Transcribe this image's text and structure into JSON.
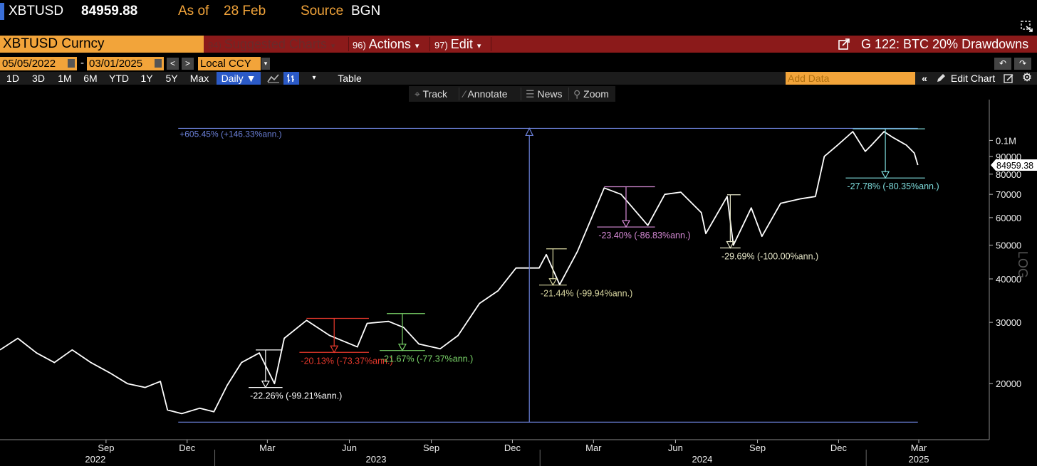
{
  "header": {
    "ticker": "XBTUSD",
    "price": "84959.88",
    "asof_label": "As of",
    "asof_date": "28 Feb",
    "source_label": "Source",
    "source_value": "BGN"
  },
  "security_bar": {
    "security": "XBTUSD Curncy",
    "menus": [
      {
        "num": "94)",
        "label": "Suggested Charts",
        "dim": true
      },
      {
        "num": "96)",
        "label": "Actions",
        "dim": false
      },
      {
        "num": "97)",
        "label": "Edit",
        "dim": false
      }
    ],
    "chart_title": "G 122: BTC 20% Drawdowns"
  },
  "range_bar": {
    "start_date": "05/05/2022",
    "end_date": "03/01/2025",
    "currency": "Local CCY"
  },
  "period_bar": {
    "periods": [
      "1D",
      "3D",
      "1M",
      "6M",
      "YTD",
      "1Y",
      "5Y",
      "Max"
    ],
    "frequency": "Daily",
    "table_label": "Table",
    "add_data_placeholder": "Add Data",
    "edit_chart_label": "Edit Chart"
  },
  "toolbar": {
    "track": "Track",
    "annotate": "Annotate",
    "news": "News",
    "zoom": "Zoom"
  },
  "chart_data": {
    "type": "line",
    "series": [
      {
        "name": "XBTUSD",
        "color": "#ffffff",
        "points": [
          [
            "2022-05-05",
            25000
          ],
          [
            "2022-05-25",
            27000
          ],
          [
            "2022-06-15",
            24500
          ],
          [
            "2022-07-05",
            23000
          ],
          [
            "2022-07-25",
            25000
          ],
          [
            "2022-08-15",
            23000
          ],
          [
            "2022-09-05",
            21500
          ],
          [
            "2022-09-25",
            20000
          ],
          [
            "2022-10-15",
            19500
          ],
          [
            "2022-11-01",
            20300
          ],
          [
            "2022-11-09",
            16800
          ],
          [
            "2022-11-25",
            16400
          ],
          [
            "2022-12-15",
            17000
          ],
          [
            "2022-12-31",
            16600
          ],
          [
            "2023-01-15",
            19800
          ],
          [
            "2023-01-31",
            23000
          ],
          [
            "2023-02-20",
            24500
          ],
          [
            "2023-03-09",
            20000
          ],
          [
            "2023-03-20",
            27000
          ],
          [
            "2023-04-14",
            30400
          ],
          [
            "2023-05-10",
            27500
          ],
          [
            "2023-06-10",
            25500
          ],
          [
            "2023-06-21",
            29800
          ],
          [
            "2023-07-15",
            30200
          ],
          [
            "2023-08-01",
            29000
          ],
          [
            "2023-08-18",
            26000
          ],
          [
            "2023-09-11",
            25200
          ],
          [
            "2023-10-01",
            27500
          ],
          [
            "2023-10-25",
            34000
          ],
          [
            "2023-11-15",
            37000
          ],
          [
            "2023-12-05",
            43000
          ],
          [
            "2023-12-31",
            43000
          ],
          [
            "2024-01-08",
            47000
          ],
          [
            "2024-01-23",
            38500
          ],
          [
            "2024-02-12",
            48000
          ],
          [
            "2024-02-28",
            60000
          ],
          [
            "2024-03-13",
            73000
          ],
          [
            "2024-04-01",
            70000
          ],
          [
            "2024-05-01",
            57000
          ],
          [
            "2024-05-20",
            70000
          ],
          [
            "2024-06-07",
            71000
          ],
          [
            "2024-06-30",
            62000
          ],
          [
            "2024-07-05",
            54000
          ],
          [
            "2024-07-29",
            69000
          ],
          [
            "2024-08-05",
            50000
          ],
          [
            "2024-08-25",
            64000
          ],
          [
            "2024-09-06",
            53000
          ],
          [
            "2024-09-27",
            66000
          ],
          [
            "2024-10-20",
            68000
          ],
          [
            "2024-11-05",
            69000
          ],
          [
            "2024-11-15",
            90000
          ],
          [
            "2024-11-30",
            97000
          ],
          [
            "2024-12-17",
            106000
          ],
          [
            "2024-12-31",
            93000
          ],
          [
            "2025-01-07",
            97000
          ],
          [
            "2025-01-21",
            106000
          ],
          [
            "2025-01-31",
            102000
          ],
          [
            "2025-02-15",
            97000
          ],
          [
            "2025-02-24",
            92000
          ],
          [
            "2025-02-28",
            84959.88
          ]
        ]
      }
    ],
    "x_start": "2022-05-05",
    "x_end": "2025-03-01",
    "ylim": [
      14000,
      125000
    ],
    "y_scale": "log",
    "y_ticks": [
      {
        "value": 20000,
        "label": "20000"
      },
      {
        "value": 30000,
        "label": "30000"
      },
      {
        "value": 40000,
        "label": "40000"
      },
      {
        "value": 50000,
        "label": "50000"
      },
      {
        "value": 60000,
        "label": "60000"
      },
      {
        "value": 70000,
        "label": "70000"
      },
      {
        "value": 80000,
        "label": "80000"
      },
      {
        "value": 90000,
        "label": "90000"
      },
      {
        "value": 100000,
        "label": "0.1M"
      }
    ],
    "y_axis_label": "LOG",
    "last_value": {
      "value": 84959.38,
      "label": "84959.38"
    },
    "x_month_ticks": [
      {
        "date": "2022-09-01",
        "label": "Sep"
      },
      {
        "date": "2022-12-01",
        "label": "Dec"
      },
      {
        "date": "2023-03-01",
        "label": "Mar"
      },
      {
        "date": "2023-06-01",
        "label": "Jun"
      },
      {
        "date": "2023-09-01",
        "label": "Sep"
      },
      {
        "date": "2023-12-01",
        "label": "Dec"
      },
      {
        "date": "2024-03-01",
        "label": "Mar"
      },
      {
        "date": "2024-06-01",
        "label": "Jun"
      },
      {
        "date": "2024-09-01",
        "label": "Sep"
      },
      {
        "date": "2024-12-01",
        "label": "Dec"
      },
      {
        "date": "2025-03-01",
        "label": "Mar"
      }
    ],
    "x_year_labels": [
      {
        "date": "2022-08-20",
        "label": "2022"
      },
      {
        "date": "2023-07-01",
        "label": "2023"
      },
      {
        "date": "2024-07-01",
        "label": "2024"
      },
      {
        "date": "2025-03-01",
        "label": "2025"
      }
    ],
    "x_year_dividers": [
      "2023-01-01",
      "2024-01-01",
      "2025-01-01"
    ],
    "drawdowns": [
      {
        "start": "2023-02-16",
        "end": "2023-03-10",
        "high": 25000,
        "low": 19500,
        "label": "-22.26% (-99.21%ann.)",
        "color": "#ffffff"
      },
      {
        "start": "2023-04-14",
        "end": "2023-06-15",
        "high": 30800,
        "low": 24600,
        "label": "-20.13% (-73.37%ann.)",
        "color": "#e8392c"
      },
      {
        "start": "2023-07-13",
        "end": "2023-08-17",
        "high": 31800,
        "low": 24900,
        "label": "-21.67% (-77.37%ann.)",
        "color": "#7bd66a"
      },
      {
        "start": "2024-01-08",
        "end": "2024-01-23",
        "high": 48800,
        "low": 38400,
        "label": "-21.44% (-99.94%ann.)",
        "color": "#d8d6a0"
      },
      {
        "start": "2024-03-13",
        "end": "2024-05-01",
        "high": 73600,
        "low": 56400,
        "label": "-23.40% (-86.83%ann.)",
        "color": "#d68ad6"
      },
      {
        "start": "2024-07-29",
        "end": "2024-08-05",
        "high": 69800,
        "low": 49100,
        "label": "-29.69% (-100.00%ann.)",
        "color": "#e6e6c8"
      },
      {
        "start": "2024-12-17",
        "end": "2025-02-28",
        "high": 108000,
        "low": 78000,
        "label": "-27.78% (-80.35%ann.)",
        "color": "#7fdede"
      }
    ],
    "range_annotation": {
      "start": "2022-11-21",
      "end": "2025-02-28",
      "mid": "2023-12-20",
      "low": 15500,
      "high": 108300,
      "label": "+605.45% (+146.33%ann.)",
      "color": "#6a7fd6"
    }
  }
}
